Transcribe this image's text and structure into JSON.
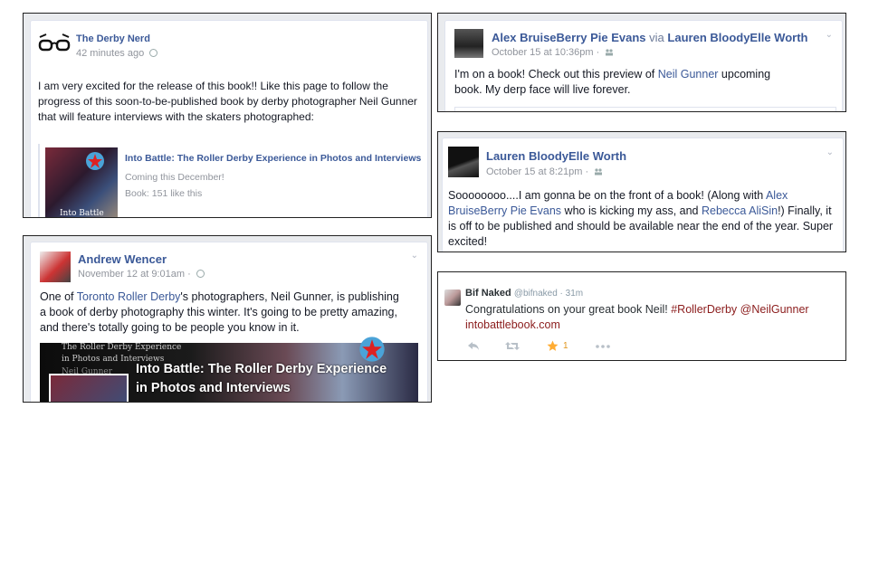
{
  "post1": {
    "author": "The Derby Nerd",
    "time": "42 minutes ago",
    "text": "I am very excited for the release of this book!! Like this page to follow the progress of this soon-to-be-published book by derby photographer Neil Gunner that will feature interviews with the skaters photographed:",
    "attachment": {
      "title": "Into Battle: The Roller Derby Experience in Photos and Interviews",
      "line1": "Coming this December!",
      "line2": "Book: 151 like this",
      "thumb_caption": "Into Battle"
    }
  },
  "post2": {
    "author": "Alex BruiseBerry Pie Evans",
    "via_word": "via",
    "via_name": "Lauren BloodyElle Worth",
    "time": "October 15 at 10:36pm ·",
    "text_before": "I'm on a book! Check out this preview of ",
    "text_link": "Neil Gunner",
    "text_after": " upcoming book. My derp face will live forever."
  },
  "post3": {
    "author": "Lauren BloodyElle Worth",
    "time": "October 15 at 8:21pm ·",
    "t1": "Soooooooo....I am gonna be on the front of a book! (Along with ",
    "l1": "Alex BruiseBerry Pie Evans",
    "t2": " who is kicking my ass, and ",
    "l2": "Rebecca AliSin",
    "t3": "!) Finally, it is off to be published and should be available near the end of the year. Super excited!"
  },
  "post4": {
    "author": "Andrew Wencer",
    "time": "November 12 at 9:01am ·",
    "text_before": "One of ",
    "text_link": "Toronto Roller Derby",
    "text_after": "'s photographers, Neil Gunner, is publishing a book of derby photography this winter. It's going to be pretty amazing, and there's totally going to be people you know in it.",
    "banner_small1": "The Roller Derby Experience",
    "banner_small2": "in Photos and Interviews",
    "banner_small3": "Neil Gunner",
    "banner_title1": "Into Battle: The Roller Derby Experience",
    "banner_title2": "in Photos and Interviews"
  },
  "tweet": {
    "name": "Bif Naked",
    "handle": "@bifnaked · 31m",
    "text_before": "Congratulations on your great book Neil! ",
    "hashtag": "#RollerDerby",
    "mention": "@NeilGunner",
    "link": "intobattlebook.com",
    "fav_count": "1"
  },
  "colors": {
    "fb_blue": "#3b5998",
    "tweet_link": "#8b1c1c",
    "star": "#ffac33"
  }
}
